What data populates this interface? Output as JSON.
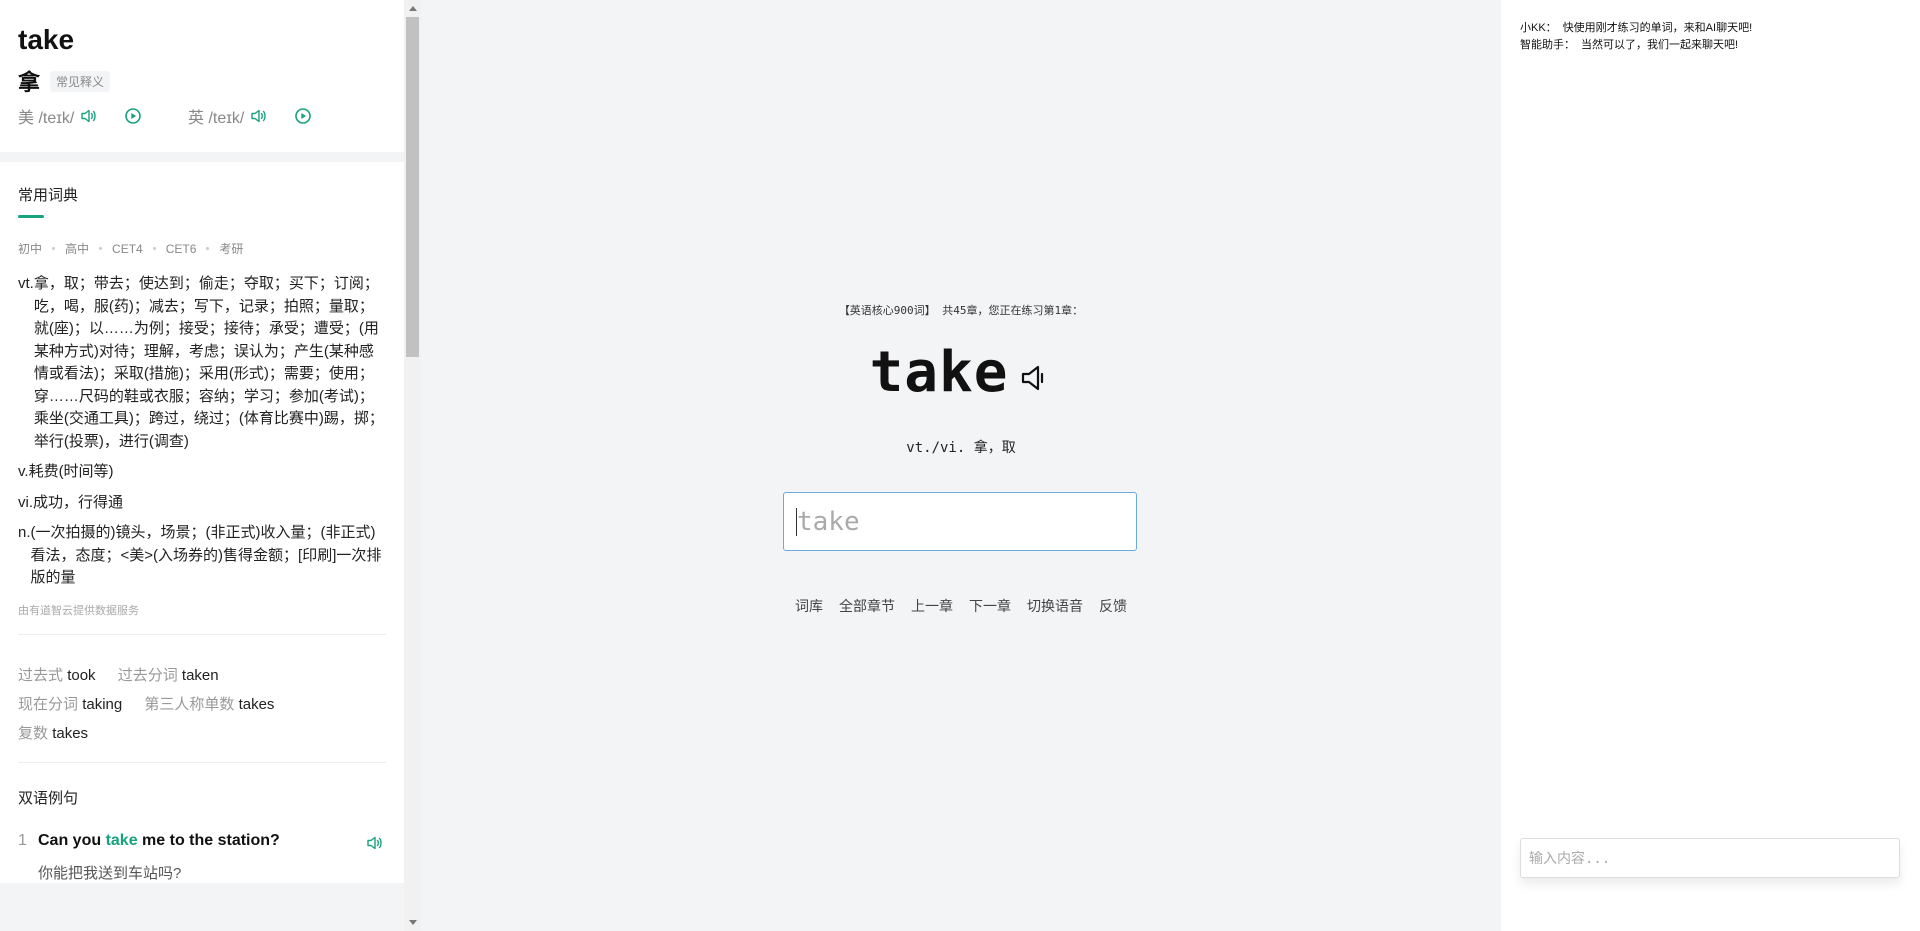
{
  "dictionary": {
    "word": "take",
    "meaning": "拿",
    "meaning_tag": "常见释义",
    "us_phonetic": "美 /teɪk/",
    "uk_phonetic": "英 /teɪk/",
    "section_title": "常用词典",
    "levels": [
      "初中",
      "高中",
      "CET4",
      "CET6",
      "考研"
    ],
    "definitions": [
      {
        "pos": "vt.",
        "text": "拿，取；带去；使达到；偷走；夺取；买下；订阅；吃，喝，服(药)；减去；写下，记录；拍照；量取；就(座)；以……为例；接受；接待；承受；遭受；(用某种方式)对待；理解，考虑；误认为；产生(某种感情或看法)；采取(措施)；采用(形式)；需要；使用；穿……尺码的鞋或衣服；容纳；学习；参加(考试)；乘坐(交通工具)；跨过，绕过；(体育比赛中)踢，掷；举行(投票)，进行(调查)"
      },
      {
        "pos": "v.",
        "text": "耗费(时间等)"
      },
      {
        "pos": "vi.",
        "text": "成功，行得通"
      },
      {
        "pos": "n.",
        "text": "(一次拍摄的)镜头，场景；(非正式)收入量；(非正式)看法，态度；<美>(入场券的)售得金额；[印刷]一次排版的量"
      }
    ],
    "source_note": "由有道智云提供数据服务",
    "forms": [
      {
        "label": "过去式",
        "value": "took"
      },
      {
        "label": "过去分词",
        "value": "taken"
      },
      {
        "label": "现在分词",
        "value": "taking"
      },
      {
        "label": "第三人称单数",
        "value": "takes"
      },
      {
        "label": "复数",
        "value": "takes"
      }
    ],
    "examples_title": "双语例句",
    "example": {
      "num": "1",
      "en_before": "Can you ",
      "en_highlight": "take",
      "en_after": " me to the station?",
      "zh": "你能把我送到车站吗?"
    }
  },
  "practice": {
    "chapter_info": "【英语核心900词】 共45章，您正在练习第1章：",
    "target_word": "take",
    "translation": "vt./vi. 拿，取",
    "input_placeholder": "take",
    "menu": [
      "词库",
      "全部章节",
      "上一章",
      "下一章",
      "切换语音",
      "反馈"
    ]
  },
  "chat": {
    "messages": [
      {
        "sender": "小KK：",
        "text": "快使用刚才练习的单词，来和AI聊天吧!"
      },
      {
        "sender": "智能助手：",
        "text": "当然可以了，我们一起来聊天吧!"
      }
    ],
    "input_placeholder": "输入内容..."
  },
  "colors": {
    "accent": "#16a37e",
    "input_border": "#6fa8dc",
    "background": "#f3f4f6"
  },
  "icons": {
    "speaker": "speaker-icon",
    "play": "play-circle-icon",
    "scroll_up": "scroll-up-arrow-icon",
    "scroll_down": "scroll-down-arrow-icon"
  }
}
